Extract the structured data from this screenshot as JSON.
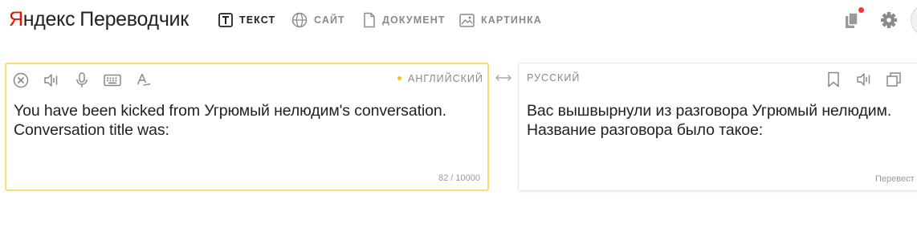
{
  "header": {
    "logo_brand_first": "Я",
    "logo_brand_rest": "ндекс",
    "logo_product": "Переводчик",
    "tabs": [
      {
        "label": "ТЕКСТ",
        "icon": "text-icon",
        "active": true
      },
      {
        "label": "САЙТ",
        "icon": "globe-icon",
        "active": false
      },
      {
        "label": "ДОКУМЕНТ",
        "icon": "document-icon",
        "active": false
      },
      {
        "label": "КАРТИНКА",
        "icon": "image-icon",
        "active": false
      }
    ],
    "right_icons": [
      "collections-icon",
      "settings-gear-icon",
      "user-avatar"
    ]
  },
  "source": {
    "language": "АНГЛИЙСКИЙ",
    "text": "You have been kicked from Угрюмый нелюдим's conversation.\nConversation title was:",
    "counter": "82 / 10000",
    "tools": [
      "clear-icon",
      "listen-icon",
      "microphone-icon",
      "keyboard-icon",
      "spellcheck-icon"
    ]
  },
  "target": {
    "language": "РУССКИЙ",
    "text": "Вас вышвырнули из разговора Угрюмый нелюдим.\nНазвание разговора было такое:",
    "feedback_label": "Перевест",
    "tools": [
      "bookmark-icon",
      "listen-icon",
      "copy-icon"
    ]
  },
  "colors": {
    "brand_red": "#e61400",
    "source_border": "#f5df6e",
    "lang_dot": "#f5c500",
    "notification_dot": "#ff3333"
  }
}
